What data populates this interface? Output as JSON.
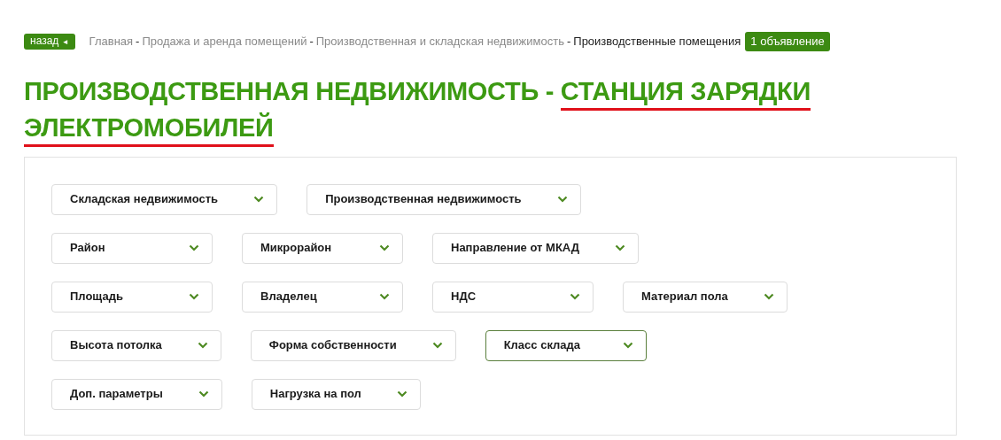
{
  "back_button": {
    "label": "назад",
    "icon": "◄"
  },
  "breadcrumbs": [
    {
      "label": "Главная",
      "current": false
    },
    {
      "label": "Продажа и аренда помещений",
      "current": false
    },
    {
      "label": "Производственная и складская недвижимость",
      "current": false
    },
    {
      "label": "Производственные помещения",
      "current": true
    }
  ],
  "breadcrumb_separator": "-",
  "count_badge": "1 объявление",
  "title": [
    {
      "text": "ПРОИЗВОДСТВЕННАЯ НЕДВИЖИМОСТЬ - ",
      "underlined": false
    },
    {
      "text": "СТАНЦИЯ ЗАРЯДКИ ЭЛЕКТРОМОБИЛЕЙ",
      "underlined": true
    }
  ],
  "filter_rows": [
    [
      {
        "label": "Складская недвижимость",
        "selected": false
      },
      {
        "label": "Производственная недвижимость",
        "selected": false
      }
    ],
    [
      {
        "label": "Район",
        "selected": false
      },
      {
        "label": "Микрорайон",
        "selected": false
      },
      {
        "label": "Направление от МКАД",
        "selected": false
      }
    ],
    [
      {
        "label": "Площадь",
        "selected": false
      },
      {
        "label": "Владелец",
        "selected": false
      },
      {
        "label": "НДС",
        "selected": false
      },
      {
        "label": "Материал пола",
        "selected": false
      }
    ],
    [
      {
        "label": "Высота потолка",
        "selected": false
      },
      {
        "label": "Форма собственности",
        "selected": false
      },
      {
        "label": "Класс склада",
        "selected": true
      }
    ],
    [
      {
        "label": "Доп. параметры",
        "selected": false
      },
      {
        "label": "Нагрузка на пол",
        "selected": false
      }
    ]
  ]
}
